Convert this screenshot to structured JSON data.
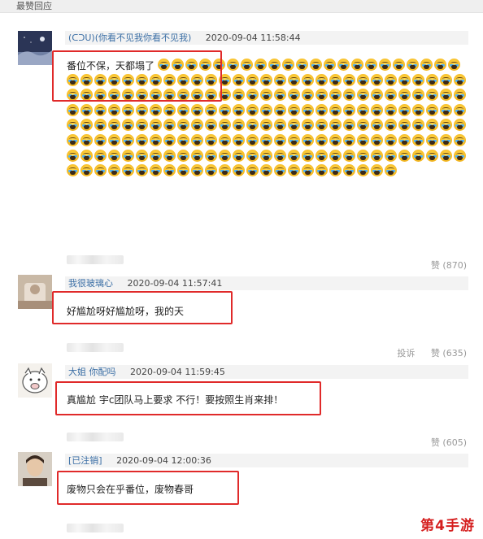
{
  "section": {
    "title": "最赞回应"
  },
  "comments": [
    {
      "user": "(ᑕᑐᑌ)(你看不见我你看不见我)",
      "time": "2020-09-04 11:58:44",
      "text": "番位不保，天都塌了",
      "emoji_icon": "crying-face-icon",
      "emoji_count": 220,
      "likes": "赞 (870)",
      "avatar_icon": "night-sky-avatar"
    },
    {
      "user": "我很玻璃心",
      "time": "2020-09-04 11:57:41",
      "text": "好尴尬呀好尴尬呀，我的天",
      "report": "投诉",
      "likes": "赞 (635)",
      "avatar_icon": "photo-avatar"
    },
    {
      "user": "大姐 你配吗",
      "time": "2020-09-04 11:59:45",
      "text": "真尴尬 宇c团队马上要求 不行！要按照生肖来排！",
      "likes": "赞 (605)",
      "avatar_icon": "cartoon-pig-avatar"
    },
    {
      "user": "[已注销]",
      "time": "2020-09-04 12:00:36",
      "text": "废物只会在乎番位，废物春哥",
      "avatar_icon": "person-avatar"
    }
  ],
  "watermark": "第4手游",
  "colors": {
    "highlight_box": "#e02a2a",
    "username": "#3a6ea5",
    "meta_bg": "#f3f3f3"
  }
}
